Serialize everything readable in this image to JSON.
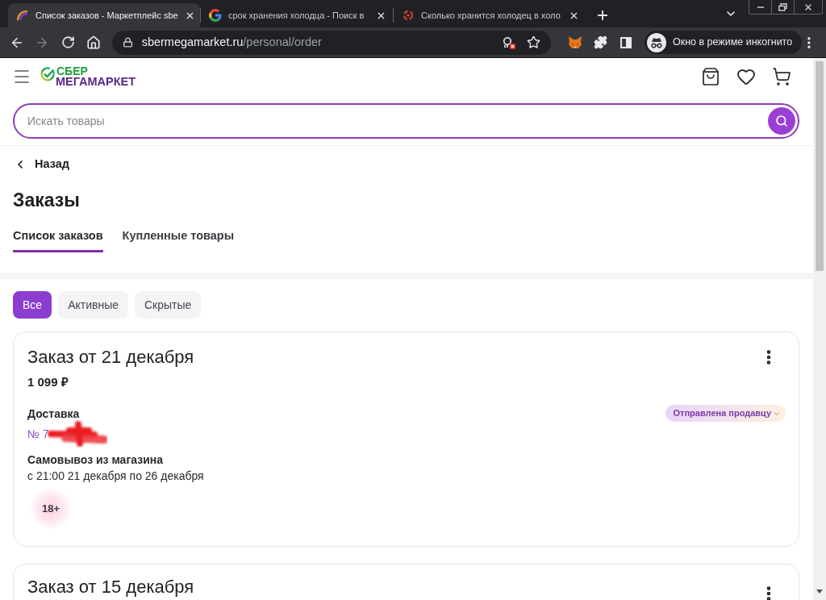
{
  "browser": {
    "tabs": [
      {
        "title": "Список заказов - Маркетплейс sbe",
        "selected": true
      },
      {
        "title": "срок хранения холодца - Поиск в",
        "selected": false
      },
      {
        "title": "Сколько хранится холодец в холо",
        "selected": false
      }
    ],
    "nav_buttons": [
      {
        "kind": "back",
        "disabled": false
      },
      {
        "kind": "forward",
        "disabled": true
      },
      {
        "kind": "reload",
        "disabled": false
      },
      {
        "kind": "home",
        "disabled": false
      }
    ],
    "address": {
      "host": "sbermegamarket.ru",
      "path": "/personal/order"
    },
    "incognito_label": "Окно в режиме инкогнито"
  },
  "header": {
    "logo": {
      "line_1": "СБЕР",
      "line_2": "МЕГАМАРКЕТ"
    },
    "search": {
      "placeholder": "Искать товары"
    }
  },
  "back_link": "Назад",
  "page_title": "Заказы",
  "tabs": [
    {
      "label": "Список заказов",
      "selected": true
    },
    {
      "label": "Купленные товары",
      "selected": false
    }
  ],
  "filters": [
    {
      "label": "Все",
      "selected": true
    },
    {
      "label": "Активные",
      "selected": false
    },
    {
      "label": "Скрытые",
      "selected": false
    }
  ],
  "orders": [
    {
      "title": "Заказ от 21 декабря",
      "price": "1 099 ₽",
      "delivery_label": "Доставка",
      "number": "№ 7",
      "status": "Отправлена продавцу",
      "pickup_label": "Самовывоз из магазина",
      "pickup_window": "с 21:00 21 декабря по 26 декабря",
      "age_badge": "18+"
    },
    {
      "title": "Заказ от 15 декабря"
    }
  ]
}
